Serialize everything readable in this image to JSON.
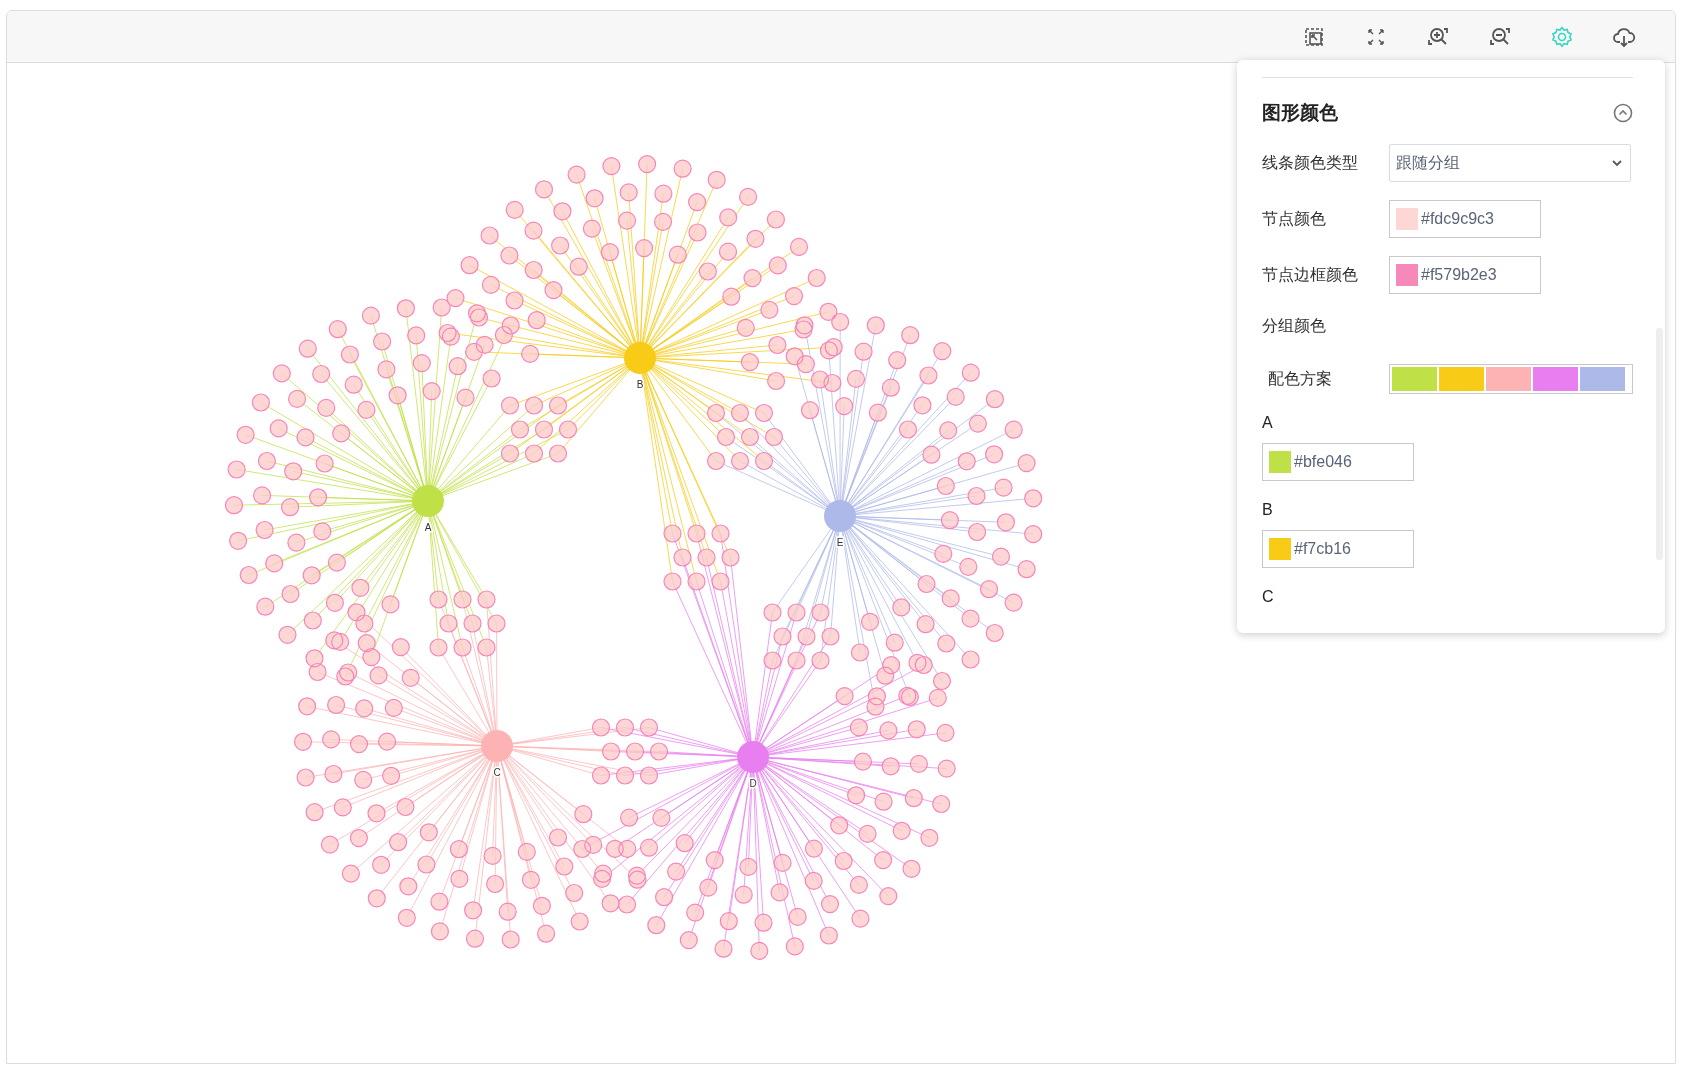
{
  "toolbar": {
    "buttons": [
      {
        "kind": "fit",
        "selected": false
      },
      {
        "kind": "fullscreen",
        "selected": false
      },
      {
        "kind": "zoom-in",
        "selected": false
      },
      {
        "kind": "zoom-out",
        "selected": false
      },
      {
        "kind": "settings",
        "selected": true
      },
      {
        "kind": "download",
        "selected": false
      }
    ]
  },
  "graph": {
    "groups": [
      {
        "label": "A"
      },
      {
        "label": "B"
      },
      {
        "label": "C"
      },
      {
        "label": "D"
      },
      {
        "label": "E"
      }
    ]
  },
  "panel": {
    "title": "图形颜色",
    "expanded": true,
    "rows": [
      {
        "kind": "select",
        "label": "线条颜色类型",
        "value": "跟随分组"
      },
      {
        "kind": "color",
        "label": "节点颜色",
        "value": "#fdc9c9c3"
      },
      {
        "kind": "color",
        "label": "节点边框颜色",
        "value": "#f579b2e3"
      },
      {
        "kind": "heading",
        "label": "分组颜色"
      },
      {
        "kind": "palette",
        "label": "配色方案",
        "colors": [
          {
            "color": "#bfe046"
          },
          {
            "color": "#f7cb16"
          },
          {
            "color": "#fdb3b3"
          },
          {
            "color": "#e87eef"
          },
          {
            "color": "#adb9e8"
          }
        ]
      },
      {
        "kind": "group-color",
        "label": "A",
        "value": "#bfe046"
      },
      {
        "kind": "group-color",
        "label": "B",
        "value": "#f7cb16"
      },
      {
        "kind": "group-label",
        "label": "C"
      }
    ]
  }
}
